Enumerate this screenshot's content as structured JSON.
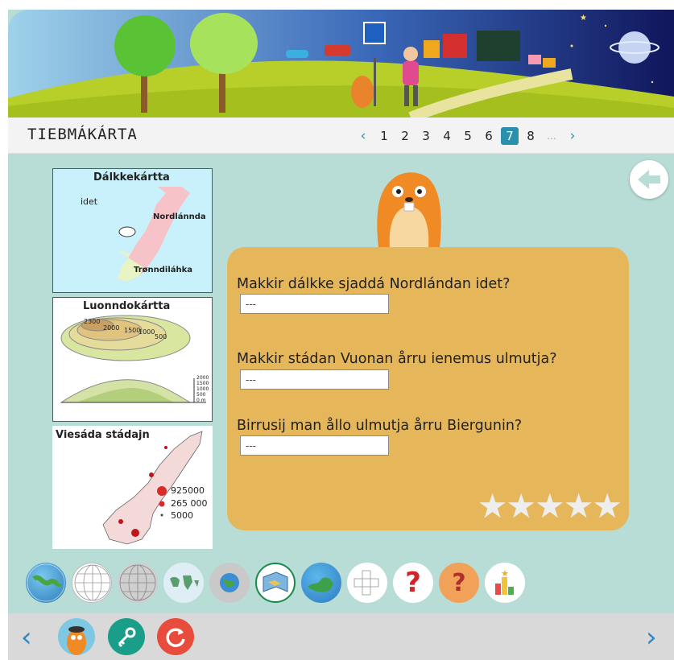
{
  "header": {
    "title": "TIEBMÁKÁRTA",
    "pager": {
      "prev": "‹",
      "pages": [
        "1",
        "2",
        "3",
        "4",
        "5",
        "6",
        "7",
        "8"
      ],
      "active": "7",
      "ellipsis": "...",
      "next": "›"
    }
  },
  "maps": {
    "weather": {
      "title": "Dálkkekártta",
      "label_idet": "idet",
      "label_nordland": "Nordlánnda",
      "label_trondelag": "Trønndiláhka"
    },
    "relief": {
      "title": "Luonndokártta",
      "contours": [
        "2300",
        "2000",
        "1500",
        "1000",
        "500"
      ],
      "scale": [
        "2000",
        "1500",
        "1000",
        "500",
        "0 m"
      ]
    },
    "population": {
      "title": "Viesáda stádajn",
      "legend": [
        "925000",
        "265 000",
        "5000"
      ]
    }
  },
  "questions": [
    {
      "text": "Makkir dálkke sjaddá Nordlándan idet?",
      "value": "---"
    },
    {
      "text": "Makkir stádan Vuonan årru ienemus ulmutja?",
      "value": "---"
    },
    {
      "text": "Birrusij man ållo ulmutja årru Biergunin?",
      "value": "---"
    }
  ],
  "rating": {
    "stars": "★★★★★",
    "filled": 0,
    "total": 5
  },
  "tools": [
    {
      "icon": "globe-grid-icon"
    },
    {
      "icon": "white-wire-globe-icon"
    },
    {
      "icon": "grey-wire-globe-icon"
    },
    {
      "icon": "world-map-icon"
    },
    {
      "icon": "small-globe-icon"
    },
    {
      "icon": "map-book-icon"
    },
    {
      "icon": "earth-icon"
    },
    {
      "icon": "crossword-icon"
    },
    {
      "icon": "question-mark-icon",
      "glyph": "?"
    },
    {
      "icon": "map-question-icon",
      "glyph": "?"
    },
    {
      "icon": "score-chart-icon"
    }
  ],
  "colors": {
    "background": "#b8dcd6",
    "card": "#e6b65a",
    "accent": "#2b8fae",
    "nav_arrow": "#2f86c6",
    "key_button": "#1a9e8a",
    "refresh_button": "#e74c3c"
  },
  "bottom_nav": {
    "prev": "‹",
    "next": "›"
  }
}
